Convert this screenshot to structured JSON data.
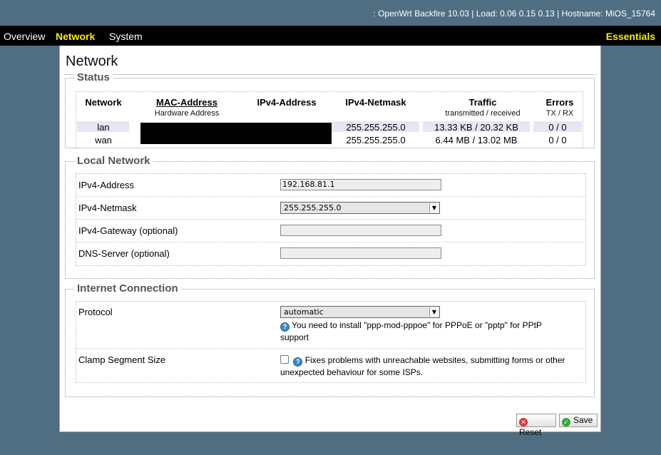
{
  "header": {
    "sysinfo": ": OpenWrt Backfire 10.03 | Load: 0.06 0.15 0.13 | Hostname: MiOS_15764"
  },
  "menu": {
    "overview": "Overview",
    "network": "Network",
    "system": "System",
    "essentials": "Essentials"
  },
  "page": {
    "title": "Network"
  },
  "status": {
    "legend": "Status",
    "headers": {
      "network": "Network",
      "mac": "MAC-Address",
      "mac_sub": "Hardware Address",
      "ipv4": "IPv4-Address",
      "netmask": "IPv4-Netmask",
      "traffic": "Traffic",
      "traffic_sub": "transmitted / received",
      "errors": "Errors",
      "errors_sub": "TX / RX"
    },
    "rows": [
      {
        "network": "lan",
        "netmask": "255.255.255.0",
        "traffic": "13.33 KB / 20.32 KB",
        "errors": "0 / 0"
      },
      {
        "network": "wan",
        "netmask": "255.255.255.0",
        "traffic": "6.44 MB / 13.02 MB",
        "errors": "0 / 0"
      }
    ]
  },
  "local_network": {
    "legend": "Local Network",
    "ipv4_label": "IPv4-Address",
    "ipv4_value": "192.168.81.1",
    "netmask_label": "IPv4-Netmask",
    "netmask_value": "255.255.255.0",
    "gateway_label": "IPv4-Gateway (optional)",
    "gateway_value": "",
    "dns_label": "DNS-Server (optional)",
    "dns_value": ""
  },
  "internet": {
    "legend": "Internet Connection",
    "protocol_label": "Protocol",
    "protocol_value": "automatic",
    "protocol_help": "You need to install \"ppp-mod-pppoe\" for PPPoE or \"pptp\" for PPtP support",
    "clamp_label": "Clamp Segment Size",
    "clamp_help": "Fixes problems with unreachable websites, submitting forms or other unexpected behaviour for some ISPs.",
    "clamp_checked": false
  },
  "buttons": {
    "reset": "Reset",
    "save": "Save"
  },
  "colors": {
    "background": "#4f6e82",
    "menubar": "#000000",
    "active_menu": "#ffea00",
    "row_highlight": "#e8e6f5"
  },
  "icons": {
    "help": "help-icon",
    "reset": "reset-icon",
    "save": "save-icon",
    "dropdown": "chevron-down-icon"
  }
}
